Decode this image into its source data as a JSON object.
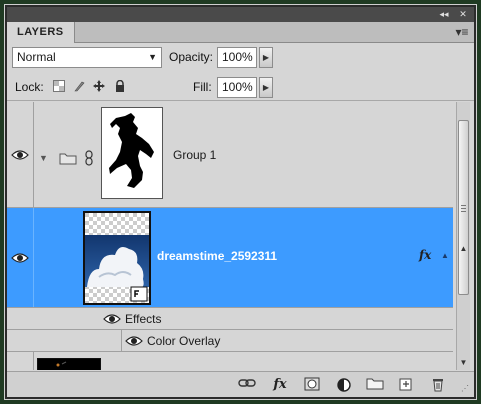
{
  "panel": {
    "tab_label": "LAYERS",
    "topbar_collapse_glyph": "◂◂",
    "topbar_close_glyph": "✕",
    "menu_glyph": "▾≡"
  },
  "blend": {
    "mode": "Normal",
    "opacity_label": "Opacity:",
    "opacity_value": "100%",
    "lock_label": "Lock:",
    "fill_label": "Fill:",
    "fill_value": "100%"
  },
  "layers": [
    {
      "name": "Group 1",
      "kind": "group",
      "visible": true,
      "selected": false
    },
    {
      "name": "dreamstime_2592311",
      "kind": "image",
      "visible": true,
      "selected": true,
      "fx_glyph": "fx",
      "fx_arrow": "▲"
    },
    {
      "name": "Effects",
      "kind": "effects-header",
      "visible": true
    },
    {
      "name": "Color Overlay",
      "kind": "effect",
      "visible": true
    }
  ],
  "bottom_icons": [
    "link-icon",
    "fx-icon",
    "mask-icon",
    "adjustment-icon",
    "folder-icon",
    "new-layer-icon",
    "trash-icon"
  ],
  "colors": {
    "selection": "#3d9bff",
    "panel_bg": "#d6d6d6",
    "frame": "#1f3a22"
  }
}
